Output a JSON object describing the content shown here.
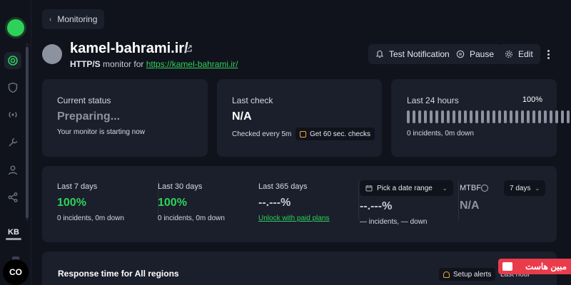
{
  "sidebar": {
    "brand_color": "#2ed15a",
    "icons": [
      "monitor-icon",
      "shield-icon",
      "broadcast-icon",
      "wrench-icon",
      "user-icon",
      "share-icon"
    ],
    "user_initials": "KB",
    "bottom_button_label": "CO"
  },
  "breadcrumb": {
    "label": "Monitoring"
  },
  "monitor": {
    "title": "kamel-bahrami.ir/",
    "type_label": "HTTP/S",
    "monitor_for": " monitor for ",
    "url": "https://kamel-bahrami.ir/"
  },
  "actions": {
    "test_notification": "Test Notification",
    "pause": "Pause",
    "edit": "Edit"
  },
  "status_cards": {
    "current_status": {
      "label": "Current status",
      "value": "Preparing...",
      "detail": "Your monitor is starting now"
    },
    "last_check": {
      "label": "Last check",
      "value": "N/A",
      "detail": "Checked every 5m",
      "badge": "Get 60 sec. checks"
    },
    "last_24_hours": {
      "label": "Last 24 hours",
      "percent": "100%",
      "detail": "0 incidents, 0m down",
      "bar_count": 29
    }
  },
  "uptime": {
    "last_7_days": {
      "label": "Last 7 days",
      "value": "100%",
      "detail": "0 incidents, 0m down"
    },
    "last_30_days": {
      "label": "Last 30 days",
      "value": "100%",
      "detail": "0 incidents, 0m down"
    },
    "last_365_days": {
      "label": "Last 365 days",
      "value": "--.---%",
      "link": "Unlock with paid plans"
    },
    "custom_range": {
      "picker_label": "Pick a date range",
      "value": "--.---%",
      "detail": "— incidents, — down"
    },
    "mtbf": {
      "label": "MTBF",
      "value": "N/A",
      "range_label": "7 days"
    }
  },
  "response_time": {
    "title": "Response time for All regions",
    "setup_alerts": "Setup alerts",
    "range_label": "Last hour"
  },
  "watermark": {
    "text": "مبین هاست"
  },
  "colors": {
    "background": "#10131c",
    "card": "#1a1f2b",
    "accent_green": "#2ed15a",
    "muted": "#8d92a0",
    "badge_orange": "#f0a53a"
  }
}
